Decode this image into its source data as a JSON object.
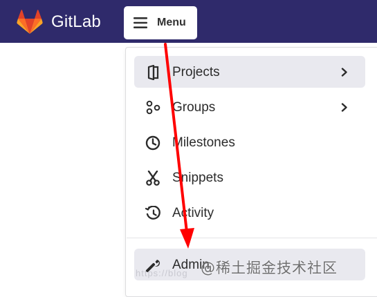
{
  "topbar": {
    "app_name": "GitLab",
    "brand_colors": {
      "bar": "#2f2a6b",
      "logo_dark": "#e24329",
      "logo_mid": "#fc6d26",
      "logo_light": "#fca326"
    },
    "menu_button_label": "Menu"
  },
  "menu": {
    "items": [
      {
        "label": "Projects",
        "icon": "project-icon",
        "has_submenu": true,
        "active": true
      },
      {
        "label": "Groups",
        "icon": "group-icon",
        "has_submenu": true,
        "active": false
      },
      {
        "label": "Milestones",
        "icon": "clock-icon",
        "has_submenu": false,
        "active": false
      },
      {
        "label": "Snippets",
        "icon": "scissors-icon",
        "has_submenu": false,
        "active": false
      },
      {
        "label": "Activity",
        "icon": "history-icon",
        "has_submenu": false,
        "active": false
      },
      {
        "label": "Admin",
        "icon": "wrench-icon",
        "has_submenu": false,
        "active": false
      }
    ]
  },
  "annotation": {
    "arrow_color": "#ff0000"
  },
  "watermark": {
    "text": "@稀土掘金技术社区",
    "faint_text": "https://blog"
  }
}
